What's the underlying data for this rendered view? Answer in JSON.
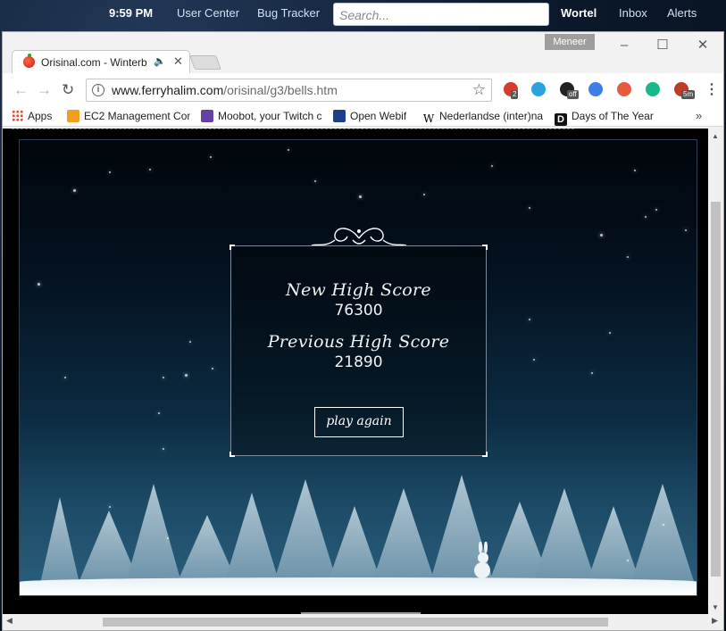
{
  "desktop_bar": {
    "time": "9:59 PM",
    "links": [
      "User Center",
      "Bug Tracker"
    ],
    "search_placeholder": "Search...",
    "right_links": [
      "Wortel",
      "Inbox",
      "Alerts"
    ]
  },
  "browser": {
    "profile_name": "Meneer",
    "tab_title": "Orisinal.com - Winterb",
    "url_host": "www.ferryhalim.com",
    "url_path": "/orisinal/g3/bells.htm",
    "extensions": [
      {
        "icon": "ublock-icon",
        "color": "#d63b2b",
        "badge": "2"
      },
      {
        "icon": "share-icon",
        "color": "#2aa3e0",
        "badge": ""
      },
      {
        "icon": "mail-icon",
        "color": "#222222",
        "badge": "off"
      },
      {
        "icon": "sync-icon",
        "color": "#3d7de8",
        "badge": ""
      },
      {
        "icon": "avatar-icon",
        "color": "#e55b3c",
        "badge": ""
      },
      {
        "icon": "chat-icon",
        "color": "#19b88a",
        "badge": ""
      },
      {
        "icon": "timer-icon",
        "color": "#c0392b",
        "badge": "5m"
      }
    ]
  },
  "bookmarks": [
    {
      "label": "Apps",
      "icon": "apps-grid-icon"
    },
    {
      "label": "EC2 Management Con",
      "icon": "aws-cube-icon"
    },
    {
      "label": "Moobot, your Twitch c",
      "icon": "twitch-icon"
    },
    {
      "label": "Open Webif",
      "icon": "ow-icon"
    },
    {
      "label": "Nederlandse (inter)na",
      "icon": "wikipedia-icon"
    },
    {
      "label": "Days of The Year",
      "icon": "d-logo-icon"
    }
  ],
  "game": {
    "new_high_label": "New High Score",
    "new_high_value": "76300",
    "prev_high_label": "Previous High Score",
    "prev_high_value": "21890",
    "play_again": "play again"
  }
}
